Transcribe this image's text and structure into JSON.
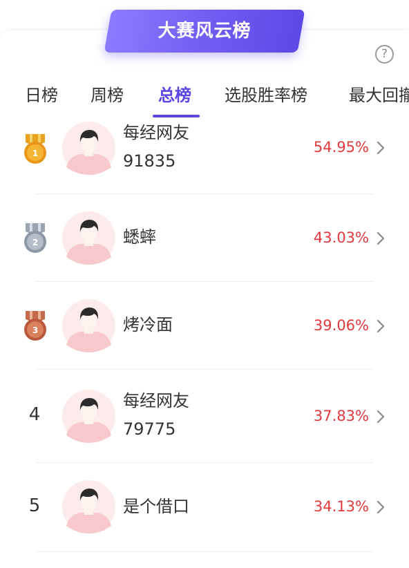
{
  "header": {
    "title": "大赛风云榜",
    "help_icon_text": "?"
  },
  "tabs": [
    {
      "label": "日榜"
    },
    {
      "label": "周榜"
    },
    {
      "label": "总榜",
      "active": true
    },
    {
      "label": "选股胜率榜"
    },
    {
      "label": "最大回撤"
    }
  ],
  "ranking": [
    {
      "rank": "1",
      "badge": "gold-medal",
      "name_line1": "每经网友",
      "name_line2": "91835",
      "rate": "54.95%"
    },
    {
      "rank": "2",
      "badge": "silver-medal",
      "name_line1": "蟋蟀",
      "name_line2": "",
      "rate": "43.03%"
    },
    {
      "rank": "3",
      "badge": "bronze-medal",
      "name_line1": "烤冷面",
      "name_line2": "",
      "rate": "39.06%"
    },
    {
      "rank": "4",
      "badge": "",
      "name_line1": "每经网友",
      "name_line2": "79775",
      "rate": "37.83%"
    },
    {
      "rank": "5",
      "badge": "",
      "name_line1": "是个借口",
      "name_line2": "",
      "rate": "34.13%"
    }
  ],
  "colors": {
    "accent": "#5b46e3",
    "rate": "#e0393e",
    "banner_start": "#8b7bff",
    "banner_end": "#5c49e6"
  }
}
